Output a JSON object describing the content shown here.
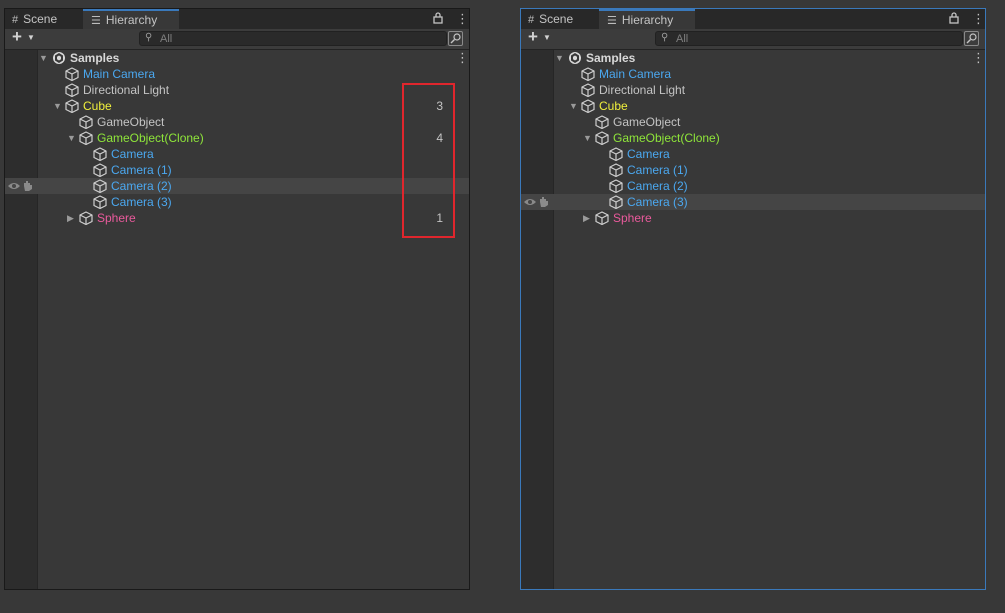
{
  "tabs": {
    "scene": "Scene",
    "hierarchy": "Hierarchy"
  },
  "search": {
    "placeholder": "All"
  },
  "root": "Samples",
  "items": {
    "main_camera": "Main Camera",
    "directional_light": "Directional Light",
    "cube": "Cube",
    "gameobject": "GameObject",
    "gameobject_clone": "GameObject(Clone)",
    "camera": "Camera",
    "camera_1": "Camera (1)",
    "camera_2": "Camera (2)",
    "camera_3": "Camera (3)",
    "sphere": "Sphere"
  },
  "counts": {
    "cube": "3",
    "gameobject_clone": "4",
    "sphere": "1"
  },
  "colors": {
    "text": "#c4c4c4",
    "prefab_blue": "#4ba8f0",
    "yellow": "#f0f03c",
    "green": "#8fe63a",
    "pink": "#ea5a9c",
    "focus_border": "#3a79bb",
    "annotation_red": "#e0262d"
  },
  "icons": [
    "scene-grid-icon",
    "hierarchy-list-icon",
    "lock-icon",
    "more-options-icon",
    "add-icon",
    "search-icon",
    "filter-icon",
    "unity-logo-icon",
    "gameobject-cube-icon",
    "visibility-eye-icon",
    "pick-hand-icon",
    "expand-arrow-icon",
    "collapse-arrow-icon"
  ]
}
